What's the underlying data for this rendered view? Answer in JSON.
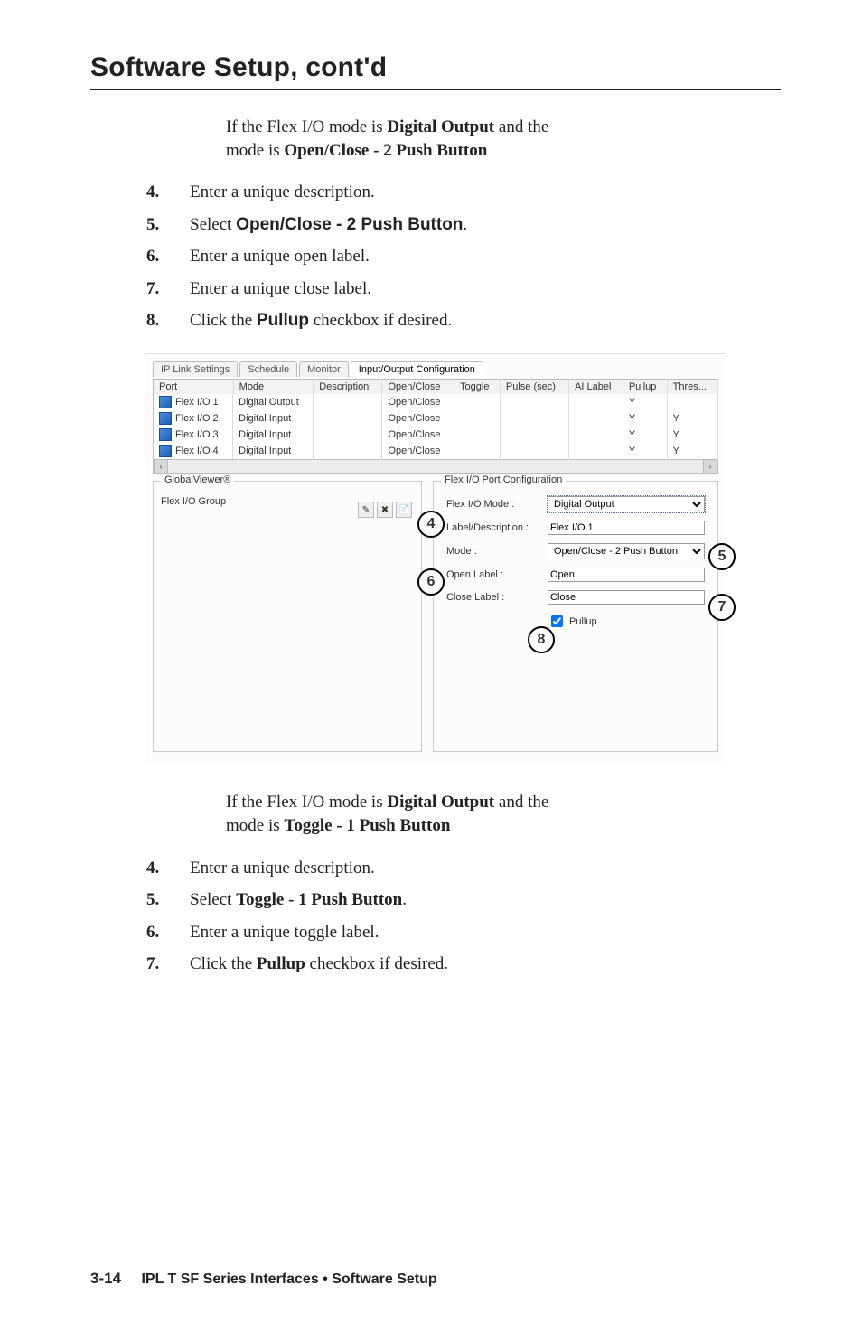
{
  "header": {
    "title": "Software Setup, cont'd"
  },
  "intro1": {
    "line1_a": "If the Flex I/O mode is ",
    "line1_b": "Digital Output",
    "line1_c": " and the",
    "line2_a": "mode is ",
    "line2_b": "Open/Close - 2 Push Button"
  },
  "stepsA": {
    "s4": {
      "num": "4",
      "a": "Enter a unique description."
    },
    "s5": {
      "num": "5",
      "a": "Select ",
      "b": "Open/Close - 2 Push Button",
      "c": "."
    },
    "s6": {
      "num": "6",
      "a": "Enter a unique open label."
    },
    "s7": {
      "num": "7",
      "a": "Enter a unique close label."
    },
    "s8": {
      "num": "8",
      "a": "Click the ",
      "b": "Pullup",
      "c": " checkbox if desired."
    }
  },
  "shot": {
    "tabs": [
      "IP Link Settings",
      "Schedule",
      "Monitor",
      "Input/Output Configuration"
    ],
    "columns": [
      "Port",
      "Mode",
      "Description",
      "Open/Close",
      "Toggle",
      "Pulse (sec)",
      "AI Label",
      "Pullup",
      "Thres..."
    ],
    "rows": [
      {
        "port": "Flex I/O 1",
        "mode": "Digital Output",
        "oc": "Open/Close",
        "pullup": "Y",
        "thres": ""
      },
      {
        "port": "Flex I/O 2",
        "mode": "Digital Input",
        "oc": "Open/Close",
        "pullup": "Y",
        "thres": "Y"
      },
      {
        "port": "Flex I/O 3",
        "mode": "Digital Input",
        "oc": "Open/Close",
        "pullup": "Y",
        "thres": "Y"
      },
      {
        "port": "Flex I/O 4",
        "mode": "Digital Input",
        "oc": "Open/Close",
        "pullup": "Y",
        "thres": "Y"
      }
    ],
    "gv": {
      "legend": "GlobalViewer®",
      "group": "Flex I/O Group"
    },
    "cfg": {
      "legend": "Flex I/O Port Configuration",
      "fio_mode_label": "Flex I/O Mode :",
      "fio_mode_value": "Digital Output",
      "desc_label": "Label/Description :",
      "desc_value": "Flex I/O 1",
      "mode_label": "Mode :",
      "mode_value": "Open/Close - 2 Push Button",
      "open_label": "Open Label :",
      "open_value": "Open",
      "close_label": "Close Label :",
      "close_value": "Close",
      "pullup_label": "Pullup"
    }
  },
  "callouts": {
    "c4": "4",
    "c5": "5",
    "c6": "6",
    "c7": "7",
    "c8": "8"
  },
  "intro2": {
    "line1_a": "If the Flex I/O mode is ",
    "line1_b": "Digital Output",
    "line1_c": " and the",
    "line2_a": "mode is ",
    "line2_b": "Toggle - 1 Push Button"
  },
  "stepsB": {
    "s4": {
      "num": "4",
      "a": "Enter a unique description."
    },
    "s5": {
      "num": "5",
      "a": "Select ",
      "b": "Toggle - 1 Push Button",
      "c": "."
    },
    "s6": {
      "num": "6",
      "a": "Enter a unique toggle label."
    },
    "s7": {
      "num": "7",
      "a": "Click the ",
      "b": "Pullup",
      "c": " checkbox if desired."
    }
  },
  "footer": {
    "page": "3-14",
    "text": "IPL T SF Series Interfaces • Software Setup"
  }
}
